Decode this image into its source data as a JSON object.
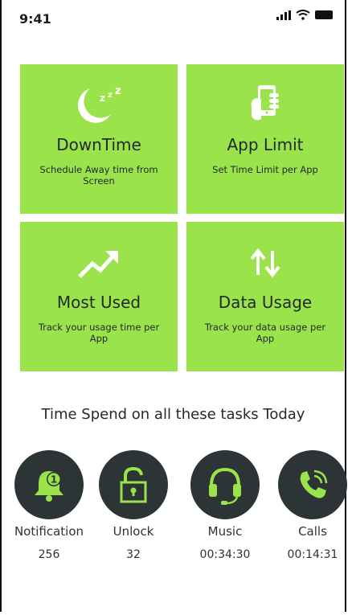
{
  "status_bar": {
    "time": "9:41"
  },
  "tiles": [
    {
      "title": "DownTime",
      "desc": "Schedule Away time from Screen",
      "icon": "moon-icon"
    },
    {
      "title": "App Limit",
      "desc": "Set Time Limit per App",
      "icon": "phone-hand-icon"
    },
    {
      "title": "Most Used",
      "desc": "Track your usage time per App",
      "icon": "trending-up-icon"
    },
    {
      "title": "Data Usage",
      "desc": "Track your data usage per App",
      "icon": "up-down-arrows-icon"
    }
  ],
  "section_heading": "Time Spend on all these tasks Today",
  "stats": [
    {
      "label": "Notification",
      "value": "256",
      "icon": "bell-icon",
      "badge": "1"
    },
    {
      "label": "Unlock",
      "value": "32",
      "icon": "unlock-icon"
    },
    {
      "label": "Music",
      "value": "00:34:30",
      "icon": "headset-icon"
    },
    {
      "label": "Calls",
      "value": "00:14:31",
      "icon": "phone-ringing-icon"
    }
  ],
  "colors": {
    "accent": "#9be34a",
    "dark": "#2c3436",
    "text": "#232a2b"
  }
}
